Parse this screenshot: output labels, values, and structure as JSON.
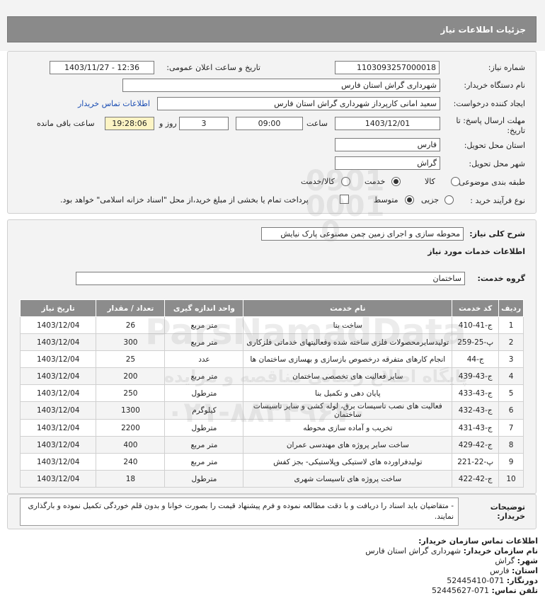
{
  "header": {
    "title": "جزئیات اطلاعات نیاز"
  },
  "form": {
    "need_number_label": "شماره نیاز:",
    "need_number": "1103093257000018",
    "announce_label": "تاریخ و ساعت اعلان عمومی:",
    "announce_value": "1403/11/27 - 12:36",
    "buyer_org_label": "نام دستگاه خریدار:",
    "buyer_org": "شهرداری گراش استان فارس",
    "creator_label": "ایجاد کننده درخواست:",
    "creator": "سعید امانی کارپرداز شهرداری گراش استان فارس",
    "contact_link": "اطلاعات تماس خریدار",
    "deadline_label_1": "مهلت ارسال پاسخ: تا",
    "deadline_label_2": "تاریخ:",
    "deadline_date": "1403/12/01",
    "time_label": "ساعت",
    "deadline_time": "09:00",
    "days_value": "3",
    "days_label": "روز و",
    "remaining_time": "19:28:06",
    "remaining_label": "ساعت باقی مانده",
    "province_label": "استان محل تحویل:",
    "province": "فارس",
    "city_label": "شهر محل تحویل:",
    "city": "گراش",
    "category_label": "طبقه بندی موضوعی:",
    "category_options": [
      "کالا",
      "خدمت",
      "کالا/خدمت"
    ],
    "category_selected": "خدمت",
    "process_label": "نوع فرآیند خرید :",
    "process_options": [
      "جزیی",
      "متوسط"
    ],
    "process_selected": "متوسط",
    "payment_note": "پرداخت تمام یا بخشی از مبلغ خرید،از محل \"اسناد خزانه اسلامی\" خواهد بود."
  },
  "details": {
    "summary_label": "شرح کلی نیاز:",
    "summary": "محوطه سازی و اجرای زمین چمن مصنوعی پارک نیایش",
    "services_heading": "اطلاعات خدمات مورد نیاز",
    "service_group_label": "گروه خدمت:",
    "service_group": "ساختمان",
    "table": {
      "headers": [
        "ردیف",
        "کد خدمت",
        "نام خدمت",
        "واحد اندازه گیری",
        "تعداد / مقدار",
        "تاریخ نیاز"
      ],
      "rows": [
        [
          "1",
          "ج-41-410",
          "ساخت بنا",
          "متر مربع",
          "26",
          "1403/12/04"
        ],
        [
          "2",
          "پ-25-259",
          "تولیدسایرمحصولات فلزی ساخته شده وفعالیتهای خدماتی فلزکاری",
          "متر مربع",
          "300",
          "1403/12/04"
        ],
        [
          "3",
          "ج-44",
          "انجام کارهای متفرقه درخصوص بازسازی و بهسازی ساختمان ها",
          "عدد",
          "25",
          "1403/12/04"
        ],
        [
          "4",
          "ج-43-439",
          "سایر فعالیت های تخصصی ساختمان",
          "متر مربع",
          "200",
          "1403/12/04"
        ],
        [
          "5",
          "ج-43-433",
          "پایان دهی و تکمیل بنا",
          "مترطول",
          "250",
          "1403/12/04"
        ],
        [
          "6",
          "ج-43-432",
          "فعالیت های نصب تاسیسات برق، لوله کشی و سایر تاسیسات ساختمان",
          "کیلوگرم",
          "1300",
          "1403/12/04"
        ],
        [
          "7",
          "ج-43-431",
          "تخریب و آماده سازی محوطه",
          "مترطول",
          "2200",
          "1403/12/04"
        ],
        [
          "8",
          "ج-42-429",
          "ساخت سایر پروژه های مهندسی عمران",
          "متر مربع",
          "400",
          "1403/12/04"
        ],
        [
          "9",
          "پ-22-221",
          "تولیدفراورده های لاستیکی وپلاستیکی- بجز کفش",
          "متر مربع",
          "240",
          "1403/12/04"
        ],
        [
          "10",
          "ج-42-422",
          "ساخت پروژه های تاسیسات شهری",
          "مترطول",
          "18",
          "1403/12/04"
        ]
      ]
    }
  },
  "notes": {
    "label": "توضیحات خریدار:",
    "text": "- متقاضیان باید اسناد را دریافت و با دقت مطالعه نموده و فرم پیشنهاد قیمت را بصورت خوانا و بدون قلم خوردگی تکمیل نموده و بارگذاری نمایند."
  },
  "contact": {
    "heading": "اطلاعات تماس سازمان خریدار:",
    "org_label": "نام سازمان خریدار:",
    "org": "شهرداری گراش استان فارس",
    "city_label": "شهر:",
    "city": "گراش",
    "province_label": "استان:",
    "province": "فارس",
    "fax_label": "دورنگار:",
    "fax": "071-52445410",
    "phone_label": "تلفن تماس:",
    "phone": "071-52445627"
  },
  "watermark": {
    "brand": "ParsNamadData",
    "persian": "پایگاه اطلاع رسانی مناقصه و مزایده",
    "phone": "۰۲۱-۸۸۳۴۹۶۷۰",
    "digits": "0901 0001 0"
  }
}
